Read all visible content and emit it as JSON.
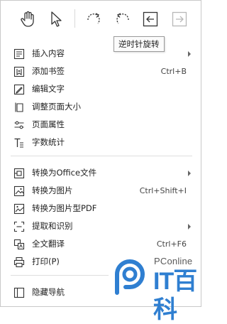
{
  "toolbar": {
    "tools": [
      {
        "name": "hand-tool",
        "icon": "hand-icon"
      },
      {
        "name": "select-tool",
        "icon": "cursor-arrow-icon"
      },
      {
        "name": "rotate-clockwise",
        "icon": "rotate-clockwise-icon"
      },
      {
        "name": "rotate-counterclockwise",
        "icon": "rotate-counterclockwise-icon"
      },
      {
        "name": "page-previous",
        "icon": "arrow-left-box-icon"
      },
      {
        "name": "page-next",
        "icon": "arrow-right-box-icon"
      }
    ],
    "tooltip": "逆时针旋转"
  },
  "menu": {
    "items": [
      {
        "label": "插入内容",
        "shortcut": "",
        "submenu": true,
        "icon": "insert-content-icon"
      },
      {
        "label": "添加书签",
        "shortcut": "Ctrl+B",
        "submenu": false,
        "icon": "bookmark-add-icon"
      },
      {
        "label": "编辑文字",
        "shortcut": "",
        "submenu": false,
        "icon": "edit-text-icon"
      },
      {
        "label": "调整页面大小",
        "shortcut": "",
        "submenu": false,
        "icon": "resize-page-icon"
      },
      {
        "label": "页面属性",
        "shortcut": "",
        "submenu": false,
        "icon": "page-properties-icon"
      },
      {
        "label": "字数统计",
        "shortcut": "",
        "submenu": false,
        "icon": "word-count-icon"
      },
      {
        "label": "转换为Office文件",
        "shortcut": "",
        "submenu": true,
        "icon": "convert-office-icon"
      },
      {
        "label": "转换为图片",
        "shortcut": "Ctrl+Shift+I",
        "submenu": false,
        "icon": "convert-image-icon"
      },
      {
        "label": "转换为图片型PDF",
        "shortcut": "",
        "submenu": false,
        "icon": "convert-image-pdf-icon"
      },
      {
        "label": "提取和识别",
        "shortcut": "",
        "submenu": true,
        "icon": "extract-ocr-icon"
      },
      {
        "label": "全文翻译",
        "shortcut": "Ctrl+F6",
        "submenu": false,
        "icon": "translate-icon"
      },
      {
        "label": "打印(P)",
        "shortcut": "",
        "submenu": false,
        "icon": "print-icon"
      },
      {
        "label": "隐藏导航",
        "shortcut": "",
        "submenu": false,
        "icon": "hide-navigation-icon"
      }
    ]
  },
  "watermark": {
    "brand_top": "PConline",
    "brand_main": "IT百科"
  },
  "colors": {
    "accent": "#2f7fd1",
    "icon_stroke": "#333333",
    "disabled": "#b8b8b8"
  }
}
